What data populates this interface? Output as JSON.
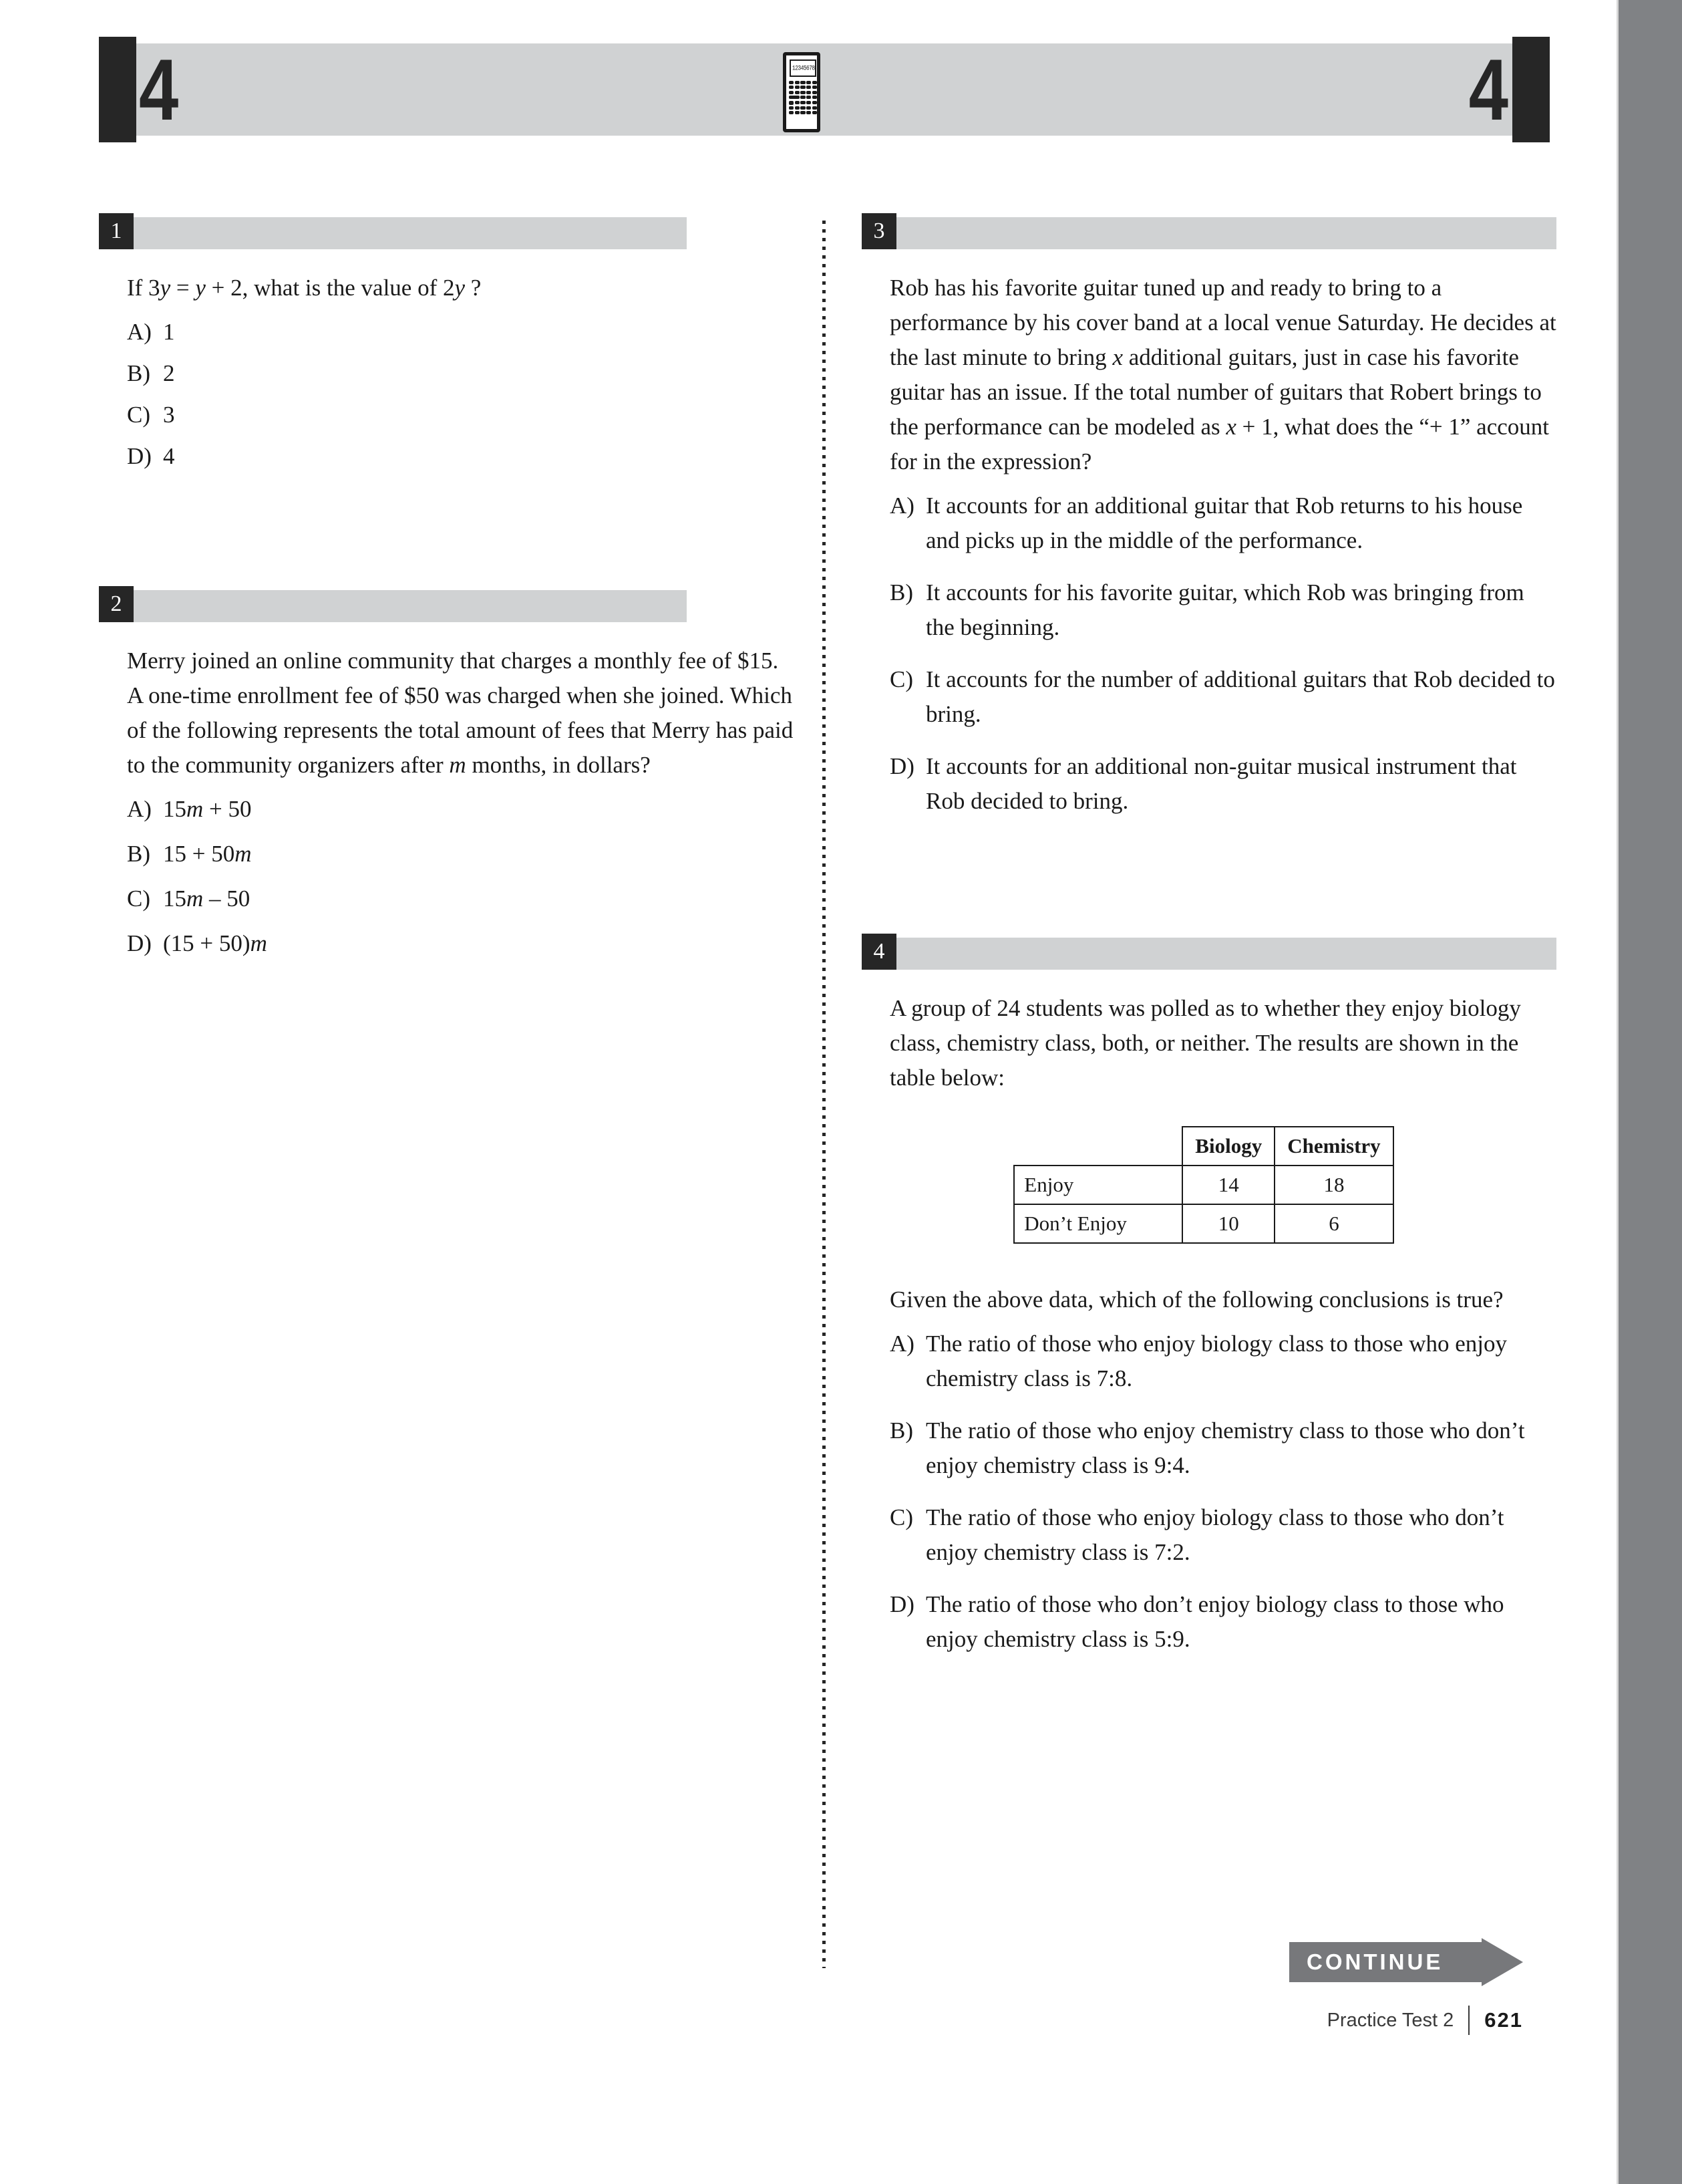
{
  "section": {
    "number_left": "4",
    "number_right": "4",
    "calculator_display": "1234567890."
  },
  "questions": [
    {
      "number": "1",
      "column": "left",
      "stem": "If 3y = y + 2, what is the value of 2y ?",
      "choices": [
        {
          "label": "A)",
          "text": "1"
        },
        {
          "label": "B)",
          "text": "2"
        },
        {
          "label": "C)",
          "text": "3"
        },
        {
          "label": "D)",
          "text": "4"
        }
      ]
    },
    {
      "number": "2",
      "column": "left",
      "stem": "Merry joined an online community that charges a monthly fee of $15. A one-time enrollment fee of $50 was charged when she joined. Which of the following represents the total amount of fees that Merry has paid to the community organizers after m months, in dollars?",
      "choices": [
        {
          "label": "A)",
          "text": "15m + 50"
        },
        {
          "label": "B)",
          "text": "15 + 50m"
        },
        {
          "label": "C)",
          "text": "15m – 50"
        },
        {
          "label": "D)",
          "text": "(15 + 50)m"
        }
      ]
    },
    {
      "number": "3",
      "column": "right",
      "stem": "Rob has his favorite guitar tuned up and ready to bring to a performance by his cover band at a local venue Saturday. He decides at the last minute to bring x additional guitars, just in case his favorite guitar has an issue. If the total number of guitars that Robert brings to the performance can be modeled as x + 1, what does the “+ 1” account for in the expression?",
      "choices": [
        {
          "label": "A)",
          "text": "It accounts for an additional guitar that Rob returns to his house and picks up in the middle of the performance."
        },
        {
          "label": "B)",
          "text": "It accounts for his favorite guitar, which Rob was bringing from the beginning."
        },
        {
          "label": "C)",
          "text": "It accounts for the number of additional guitars that Rob decided to bring."
        },
        {
          "label": "D)",
          "text": "It accounts for an additional non-guitar musical instrument that Rob decided to bring."
        }
      ]
    },
    {
      "number": "4",
      "column": "right",
      "stem": "A group of 24 students was polled as to whether they enjoy biology class, chemistry class, both, or neither. The results are shown in the table below:",
      "stem_after_table": "Given the above data, which of the following conclusions is true?",
      "choices": [
        {
          "label": "A)",
          "text": "The ratio of those who enjoy biology class to those who enjoy chemistry class is 7:8."
        },
        {
          "label": "B)",
          "text": "The ratio of those who enjoy chemistry class to those who don’t enjoy chemistry class is 9:4."
        },
        {
          "label": "C)",
          "text": "The ratio of those who enjoy biology class to those who don’t enjoy chemistry class is 7:2."
        },
        {
          "label": "D)",
          "text": "The ratio of those who don’t enjoy biology class to those who enjoy chemistry class is 5:9."
        }
      ]
    }
  ],
  "chart_data": {
    "type": "table",
    "title": "",
    "corner_label": "",
    "columns": [
      "Biology",
      "Chemistry"
    ],
    "rows": [
      {
        "label": "Enjoy",
        "values": [
          14,
          18
        ]
      },
      {
        "label": "Don’t Enjoy",
        "values": [
          10,
          6
        ]
      }
    ],
    "total_students": 24
  },
  "footer": {
    "continue_label": "CONTINUE",
    "test_name": "Practice Test 2",
    "page_number": "621"
  },
  "colors": {
    "bar_gray": "#d0d2d3",
    "badge_black": "#262626",
    "gutter_gray": "#808285",
    "continue_gray": "#77787b"
  }
}
